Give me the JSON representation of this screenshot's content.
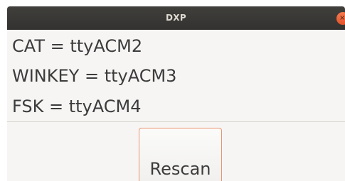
{
  "window": {
    "title": "DXP",
    "close_icon": "close-icon",
    "accent": "#e95420"
  },
  "ports": [
    {
      "text": "CAT = ttyACM2"
    },
    {
      "text": "WINKEY = ttyACM3"
    },
    {
      "text": "FSK = ttyACM4"
    }
  ],
  "actions": {
    "rescan_label": "Rescan"
  }
}
